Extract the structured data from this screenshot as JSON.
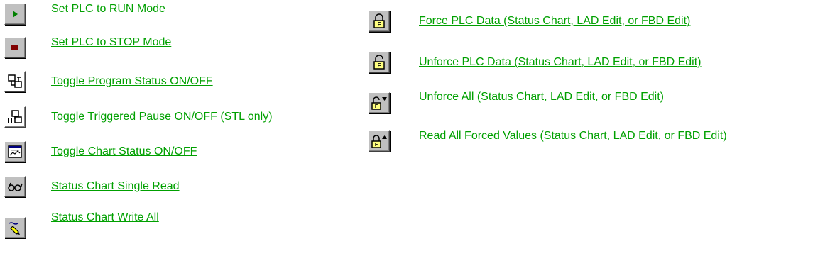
{
  "left_items": [
    {
      "icon": "run-icon",
      "label": "Set PLC to RUN Mode"
    },
    {
      "icon": "stop-icon",
      "label": "Set PLC to STOP Mode"
    },
    {
      "icon": "program-status-icon",
      "label": "Toggle Program Status ON/OFF"
    },
    {
      "icon": "triggered-pause-icon",
      "label": "Toggle Triggered Pause ON/OFF (STL only)"
    },
    {
      "icon": "chart-status-icon",
      "label": "Toggle Chart Status ON/OFF"
    },
    {
      "icon": "glasses-icon",
      "label": "Status Chart Single Read"
    },
    {
      "icon": "pen-write-icon",
      "label": "Status Chart Write All"
    }
  ],
  "right_items": [
    {
      "icon": "lock-icon",
      "label": "Force PLC Data (Status Chart, LAD Edit, or FBD Edit)"
    },
    {
      "icon": "unlock-icon",
      "label": "Unforce PLC Data (Status Chart, LAD Edit, or FBD Edit)"
    },
    {
      "icon": "unforce-all-icon",
      "label": "Unforce All (Status Chart, LAD Edit, or FBD Edit)"
    },
    {
      "icon": "read-forced-icon",
      "label": "Read All Forced Values (Status Chart, LAD Edit, or FBD Edit)"
    }
  ],
  "colors": {
    "link": "#00a000",
    "button_face": "#c0c0c0",
    "run": "#008000",
    "stop": "#800000"
  }
}
